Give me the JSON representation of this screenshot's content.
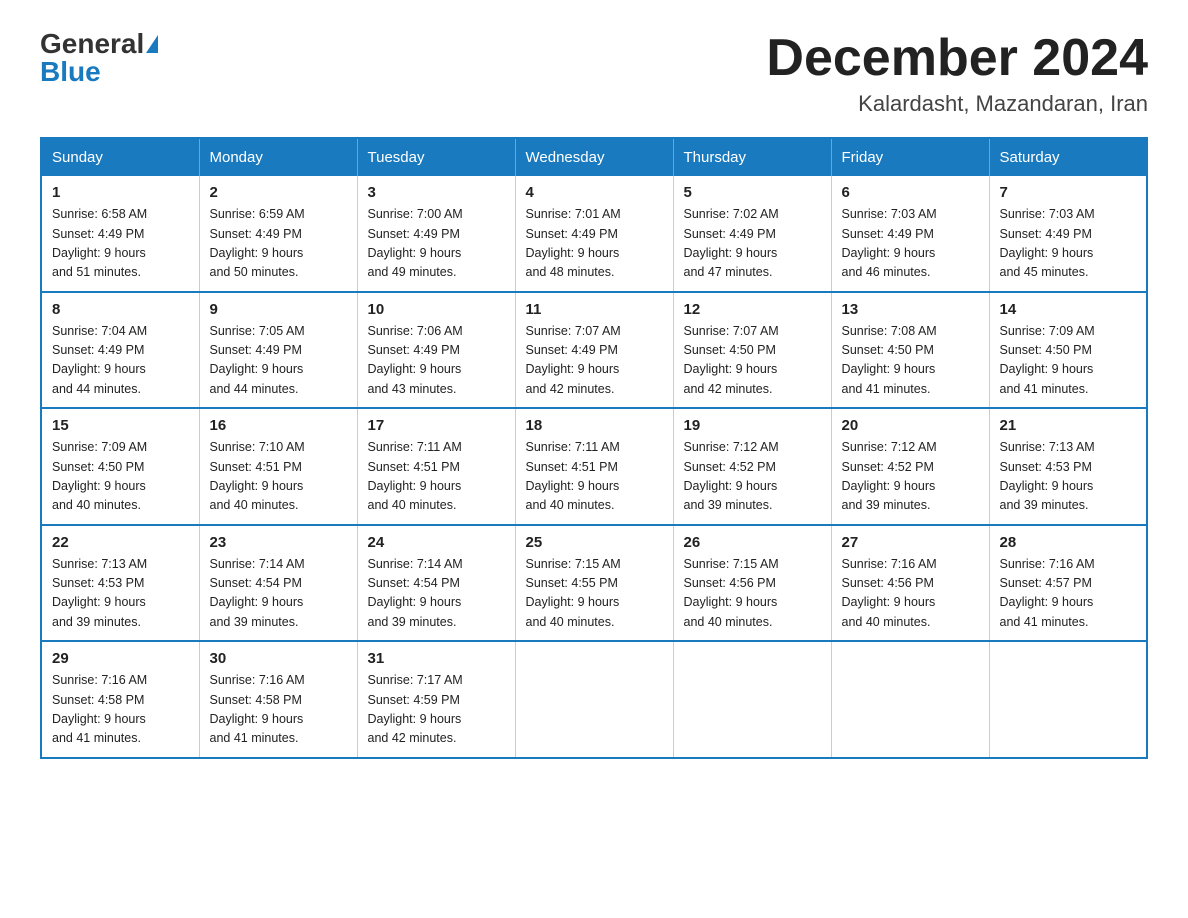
{
  "header": {
    "logo_general": "General",
    "logo_blue": "Blue",
    "month_title": "December 2024",
    "location": "Kalardasht, Mazandaran, Iran"
  },
  "days_of_week": [
    "Sunday",
    "Monday",
    "Tuesday",
    "Wednesday",
    "Thursday",
    "Friday",
    "Saturday"
  ],
  "weeks": [
    [
      {
        "day": "1",
        "sunrise": "6:58 AM",
        "sunset": "4:49 PM",
        "daylight": "9 hours and 51 minutes."
      },
      {
        "day": "2",
        "sunrise": "6:59 AM",
        "sunset": "4:49 PM",
        "daylight": "9 hours and 50 minutes."
      },
      {
        "day": "3",
        "sunrise": "7:00 AM",
        "sunset": "4:49 PM",
        "daylight": "9 hours and 49 minutes."
      },
      {
        "day": "4",
        "sunrise": "7:01 AM",
        "sunset": "4:49 PM",
        "daylight": "9 hours and 48 minutes."
      },
      {
        "day": "5",
        "sunrise": "7:02 AM",
        "sunset": "4:49 PM",
        "daylight": "9 hours and 47 minutes."
      },
      {
        "day": "6",
        "sunrise": "7:03 AM",
        "sunset": "4:49 PM",
        "daylight": "9 hours and 46 minutes."
      },
      {
        "day": "7",
        "sunrise": "7:03 AM",
        "sunset": "4:49 PM",
        "daylight": "9 hours and 45 minutes."
      }
    ],
    [
      {
        "day": "8",
        "sunrise": "7:04 AM",
        "sunset": "4:49 PM",
        "daylight": "9 hours and 44 minutes."
      },
      {
        "day": "9",
        "sunrise": "7:05 AM",
        "sunset": "4:49 PM",
        "daylight": "9 hours and 44 minutes."
      },
      {
        "day": "10",
        "sunrise": "7:06 AM",
        "sunset": "4:49 PM",
        "daylight": "9 hours and 43 minutes."
      },
      {
        "day": "11",
        "sunrise": "7:07 AM",
        "sunset": "4:49 PM",
        "daylight": "9 hours and 42 minutes."
      },
      {
        "day": "12",
        "sunrise": "7:07 AM",
        "sunset": "4:50 PM",
        "daylight": "9 hours and 42 minutes."
      },
      {
        "day": "13",
        "sunrise": "7:08 AM",
        "sunset": "4:50 PM",
        "daylight": "9 hours and 41 minutes."
      },
      {
        "day": "14",
        "sunrise": "7:09 AM",
        "sunset": "4:50 PM",
        "daylight": "9 hours and 41 minutes."
      }
    ],
    [
      {
        "day": "15",
        "sunrise": "7:09 AM",
        "sunset": "4:50 PM",
        "daylight": "9 hours and 40 minutes."
      },
      {
        "day": "16",
        "sunrise": "7:10 AM",
        "sunset": "4:51 PM",
        "daylight": "9 hours and 40 minutes."
      },
      {
        "day": "17",
        "sunrise": "7:11 AM",
        "sunset": "4:51 PM",
        "daylight": "9 hours and 40 minutes."
      },
      {
        "day": "18",
        "sunrise": "7:11 AM",
        "sunset": "4:51 PM",
        "daylight": "9 hours and 40 minutes."
      },
      {
        "day": "19",
        "sunrise": "7:12 AM",
        "sunset": "4:52 PM",
        "daylight": "9 hours and 39 minutes."
      },
      {
        "day": "20",
        "sunrise": "7:12 AM",
        "sunset": "4:52 PM",
        "daylight": "9 hours and 39 minutes."
      },
      {
        "day": "21",
        "sunrise": "7:13 AM",
        "sunset": "4:53 PM",
        "daylight": "9 hours and 39 minutes."
      }
    ],
    [
      {
        "day": "22",
        "sunrise": "7:13 AM",
        "sunset": "4:53 PM",
        "daylight": "9 hours and 39 minutes."
      },
      {
        "day": "23",
        "sunrise": "7:14 AM",
        "sunset": "4:54 PM",
        "daylight": "9 hours and 39 minutes."
      },
      {
        "day": "24",
        "sunrise": "7:14 AM",
        "sunset": "4:54 PM",
        "daylight": "9 hours and 39 minutes."
      },
      {
        "day": "25",
        "sunrise": "7:15 AM",
        "sunset": "4:55 PM",
        "daylight": "9 hours and 40 minutes."
      },
      {
        "day": "26",
        "sunrise": "7:15 AM",
        "sunset": "4:56 PM",
        "daylight": "9 hours and 40 minutes."
      },
      {
        "day": "27",
        "sunrise": "7:16 AM",
        "sunset": "4:56 PM",
        "daylight": "9 hours and 40 minutes."
      },
      {
        "day": "28",
        "sunrise": "7:16 AM",
        "sunset": "4:57 PM",
        "daylight": "9 hours and 41 minutes."
      }
    ],
    [
      {
        "day": "29",
        "sunrise": "7:16 AM",
        "sunset": "4:58 PM",
        "daylight": "9 hours and 41 minutes."
      },
      {
        "day": "30",
        "sunrise": "7:16 AM",
        "sunset": "4:58 PM",
        "daylight": "9 hours and 41 minutes."
      },
      {
        "day": "31",
        "sunrise": "7:17 AM",
        "sunset": "4:59 PM",
        "daylight": "9 hours and 42 minutes."
      },
      null,
      null,
      null,
      null
    ]
  ],
  "labels": {
    "sunrise": "Sunrise:",
    "sunset": "Sunset:",
    "daylight": "Daylight:"
  }
}
